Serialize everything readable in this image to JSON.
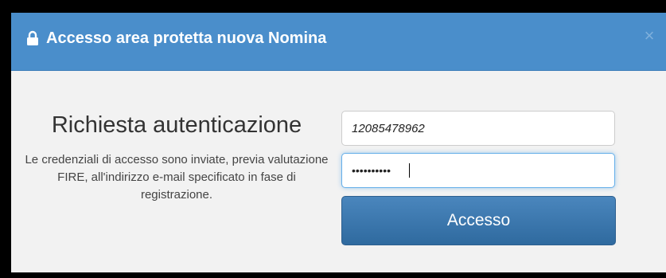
{
  "header": {
    "title": "Accesso area protetta nuova Nomina",
    "lock_icon": "lock-icon",
    "close_icon": "close-icon",
    "close_label": "×",
    "background_color": "#4a8ecb"
  },
  "auth": {
    "heading": "Richiesta autenticazione",
    "description": "Le credenziali di accesso sono inviate, previa valutazione FIRE, all'indirizzo e-mail specificato in fase di registrazione."
  },
  "form": {
    "username_value": "12085478962",
    "password_value": "••••••••••",
    "login_button_label": "Accesso",
    "button_color": "#2f6a9f"
  }
}
